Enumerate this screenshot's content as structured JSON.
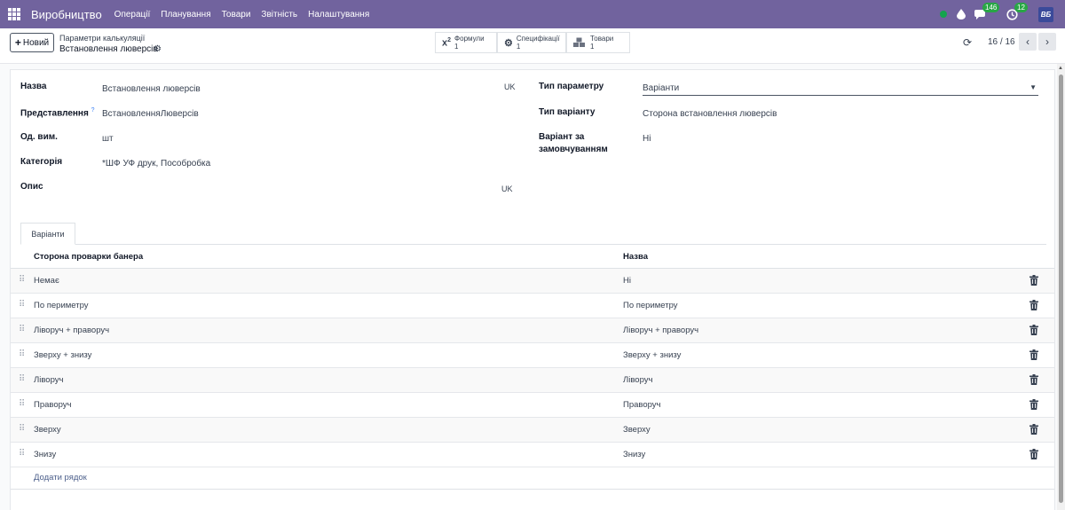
{
  "navbar": {
    "brand": "Виробництво",
    "menu": [
      "Операції",
      "Планування",
      "Товари",
      "Звітність",
      "Налаштування"
    ],
    "chat_count": "146",
    "activity_count": "12",
    "avatar_text": "ВБ"
  },
  "control": {
    "new_button": "Новий",
    "breadcrumb_parent": "Параметри калькуляції",
    "breadcrumb_current": "Встановлення люверсів",
    "smart_buttons": [
      {
        "icon": "x2-formula-icon",
        "label": "Формули",
        "count": "1"
      },
      {
        "icon": "gears-icon",
        "label": "Специфікації",
        "count": "1"
      },
      {
        "icon": "cubes-icon",
        "label": "Товари",
        "count": "1"
      }
    ],
    "pager": "16 / 16"
  },
  "form": {
    "left": [
      {
        "label": "Назва",
        "value": "Встановлення люверсів",
        "lang": "UK"
      },
      {
        "label": "Представлення",
        "value": "ВстановленняЛюверсів",
        "help": "?"
      },
      {
        "label": "Од. вим.",
        "value": "шт"
      },
      {
        "label": "Категорія",
        "value": "*ШФ УФ друк, Пособробка"
      },
      {
        "label": "Опис",
        "value": "",
        "lang": "UK"
      }
    ],
    "right": [
      {
        "label": "Тип параметру",
        "value": "Варіанти"
      },
      {
        "label": "Тип варіанту",
        "value": "Сторона встановлення люверсів"
      },
      {
        "label": "Варіант за замовчуванням",
        "value": "Ні"
      }
    ]
  },
  "tab": {
    "label": "Варіанти"
  },
  "table": {
    "columns": [
      "Сторона проварки банера",
      "Назва"
    ],
    "rows": [
      [
        "Немає",
        "Ні"
      ],
      [
        "По периметру",
        "По периметру"
      ],
      [
        "Ліворуч + праворуч",
        "Ліворуч + праворуч"
      ],
      [
        "Зверху + знизу",
        "Зверху + знизу"
      ],
      [
        "Ліворуч",
        "Ліворуч"
      ],
      [
        "Праворуч",
        "Праворуч"
      ],
      [
        "Зверху",
        "Зверху"
      ],
      [
        "Знизу",
        "Знизу"
      ]
    ],
    "add_line": "Додати рядок"
  },
  "colors": {
    "navbar": "#71639e",
    "online": "#14a44d",
    "badge": "#28a745",
    "link": "#4b5e8a"
  }
}
